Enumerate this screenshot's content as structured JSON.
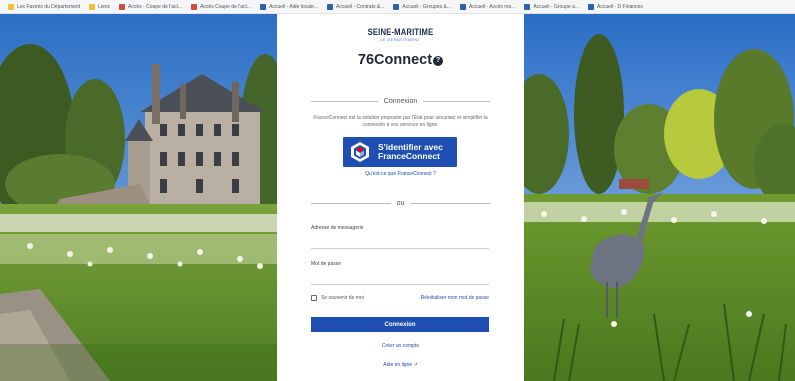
{
  "bookmarks": [
    {
      "label": "Les Favoris du Département",
      "icon": "folder-icon",
      "color": "#f2c230"
    },
    {
      "label": "Liens",
      "icon": "folder-icon",
      "color": "#f2c230"
    },
    {
      "label": "Accès - Coupe de l'act...",
      "icon": "bookmark-icon",
      "color": "#d94c3d"
    },
    {
      "label": "Accès Coupe de l'act...",
      "icon": "bookmark-icon",
      "color": "#d94c3d"
    },
    {
      "label": "Accueil - Aide locale...",
      "icon": "site-icon",
      "color": "#2f5fb3"
    },
    {
      "label": "Accueil - Contrats &...",
      "icon": "site-icon",
      "color": "#2f5fb3"
    },
    {
      "label": "Accueil - Groupes &...",
      "icon": "site-icon",
      "color": "#2f5fb3"
    },
    {
      "label": "Accueil - Accès res...",
      "icon": "site-icon",
      "color": "#2f5fb3"
    },
    {
      "label": "Accueil - Groupe a...",
      "icon": "site-icon",
      "color": "#2f5fb3"
    },
    {
      "label": "Accueil - D Finances",
      "icon": "site-icon",
      "color": "#2f5fb3"
    }
  ],
  "brand": {
    "logo_main": "SEINE-MARITIME",
    "logo_sub": "LE DÉPARTEMENT",
    "app_title": "76Connect",
    "help_icon": "?"
  },
  "connexion_separator": "Connexion",
  "franceconnect": {
    "description": "FranceConnect est la solution proposée par l'État pour sécuriser et simplifier la connexion à vos services en ligne.",
    "button_line1": "S'identifier avec",
    "button_line2": "FranceConnect",
    "info_link": "Qu'est-ce que FranceConnect ?"
  },
  "or_separator": "ou",
  "form": {
    "email_label": "Adresse de messagerie",
    "email_value": "",
    "password_label": "Mot de passe",
    "password_value": "",
    "remember_label": "Se souvenir de moi",
    "remember_checked": false,
    "reset_link": "Réinitialiser mon mot de passe",
    "submit_label": "Connexion"
  },
  "links": {
    "create_account": "Créer un compte",
    "online_help": "Aide en ligne"
  },
  "colors": {
    "primary": "#1f4fb2",
    "brand_dark": "#1d2a55"
  }
}
